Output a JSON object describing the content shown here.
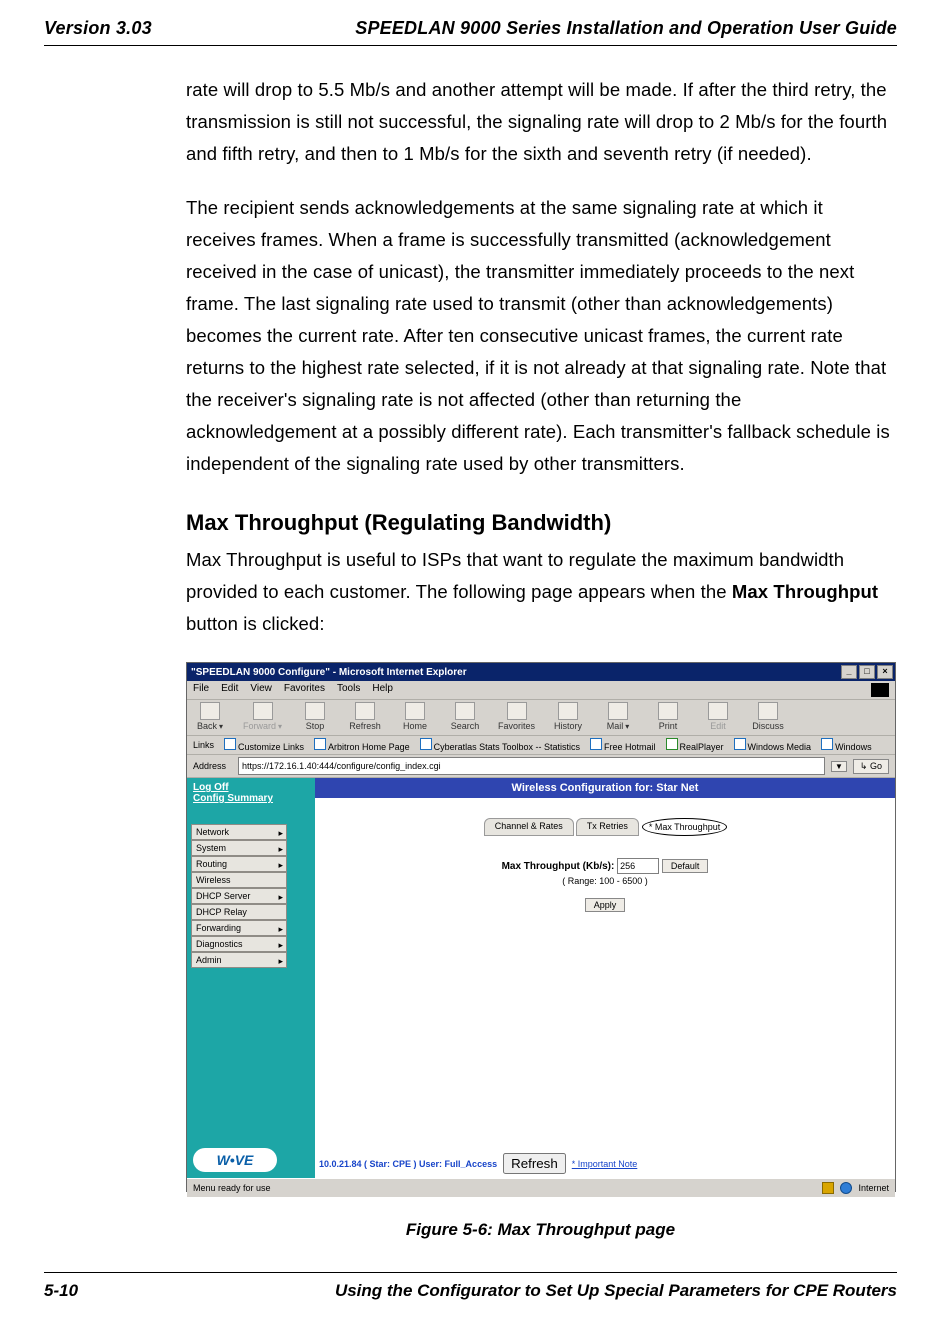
{
  "header": {
    "version": "Version 3.03",
    "title": "SPEEDLAN 9000 Series Installation and Operation User Guide"
  },
  "body": {
    "p1": "rate will drop to 5.5 Mb/s and another attempt will be made. If after the third retry, the transmission is still not successful, the signaling rate will drop to 2 Mb/s for the fourth and fifth retry, and then to 1 Mb/s for the sixth and seventh retry (if needed).",
    "p2": "The recipient sends acknowledgements at the same signaling rate at which it receives frames. When a frame is successfully transmitted (acknowledgement received in the case of unicast), the transmitter immediately proceeds to the next frame. The last signaling rate used to transmit (other than acknowledgements) becomes the current rate. After ten consecutive unicast frames, the current rate returns to the highest rate selected, if it is not already at that signaling rate. Note that the receiver's signaling rate is not affected (other than returning the acknowledgement at a possibly different rate). Each transmitter's fallback schedule is independent of the signaling rate used by other transmitters.",
    "h2": "Max Throughput (Regulating Bandwidth)",
    "p3a": "Max Throughput is useful to ISPs that want to regulate the maximum bandwidth provided to each customer. The following page appears when the ",
    "p3b": "Max Throughput",
    "p3c": " button is clicked:"
  },
  "screenshot": {
    "window_title": "\"SPEEDLAN 9000 Configure\" - Microsoft Internet Explorer",
    "menus": [
      "File",
      "Edit",
      "View",
      "Favorites",
      "Tools",
      "Help"
    ],
    "toolbar": [
      {
        "label": "Back",
        "disabled": false,
        "arrow": true
      },
      {
        "label": "Forward",
        "disabled": true,
        "arrow": true
      },
      {
        "label": "Stop",
        "disabled": false
      },
      {
        "label": "Refresh",
        "disabled": false
      },
      {
        "label": "Home",
        "disabled": false
      },
      {
        "label": "Search",
        "disabled": false
      },
      {
        "label": "Favorites",
        "disabled": false
      },
      {
        "label": "History",
        "disabled": false
      },
      {
        "label": "Mail",
        "disabled": false,
        "arrow": true
      },
      {
        "label": "Print",
        "disabled": false
      },
      {
        "label": "Edit",
        "disabled": true
      },
      {
        "label": "Discuss",
        "disabled": false
      }
    ],
    "links_label": "Links",
    "links": [
      "Customize Links",
      "Arbitron Home Page",
      "Cyberatlas Stats Toolbox -- Statistics",
      "Free Hotmail",
      "RealPlayer",
      "Windows Media",
      "Windows"
    ],
    "address_label": "Address",
    "address_value": "https://172.16.1.40:444/configure/config_index.cgi",
    "go_label": "Go",
    "sidebar": {
      "top_links": [
        "Log Off",
        "Config Summary"
      ],
      "menu_items": [
        "Network",
        "System",
        "Routing",
        "Wireless",
        "DHCP Server",
        "DHCP Relay",
        "Forwarding",
        "Diagnostics",
        "Admin"
      ],
      "logo_text": "W•VE"
    },
    "main": {
      "heading": "Wireless Configuration for: Star Net",
      "tabs": [
        "Channel & Rates",
        "Tx Retries",
        "* Max Throughput"
      ],
      "form": {
        "label": "Max Throughput (Kb/s):",
        "value": "256",
        "default_btn": "Default",
        "range": "( Range: 100 - 6500 )",
        "apply_btn": "Apply"
      },
      "footer_info": "10.0.21.84 ( Star: CPE ) User: Full_Access",
      "refresh_btn": "Refresh",
      "important_note": "* Important Note"
    },
    "statusbar": {
      "left": "Menu ready for use",
      "right": "Internet"
    }
  },
  "figure_caption": "Figure 5-6: Max Throughput page",
  "footer": {
    "page_num": "5-10",
    "title": "Using the Configurator to Set Up Special Parameters for CPE Routers"
  }
}
